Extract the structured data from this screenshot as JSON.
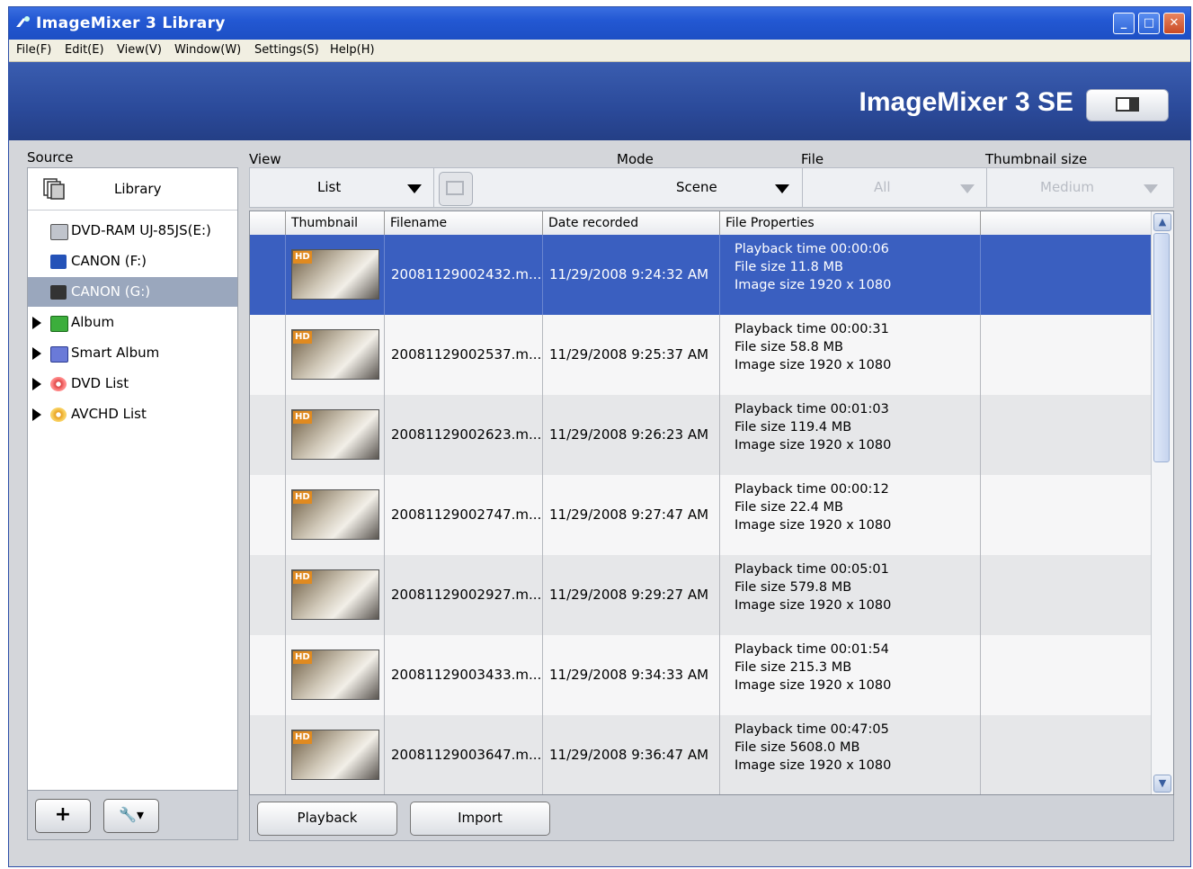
{
  "window": {
    "title": "ImageMixer 3 Library"
  },
  "menu": [
    "File(F)",
    "Edit(E)",
    "View(V)",
    "Window(W)",
    "Settings(S)",
    "Help(H)"
  ],
  "brand": {
    "logo": "ImageMixer 3 SE"
  },
  "source": {
    "label": "Source",
    "library": "Library",
    "items": [
      {
        "label": "DVD-RAM UJ-85JS(E:)",
        "icon": "dvd-drive-icon"
      },
      {
        "label": "CANON (F:)",
        "icon": "memory-card-icon"
      },
      {
        "label": "CANON (G:)",
        "icon": "camcorder-icon",
        "selected": true
      },
      {
        "label": "Album",
        "icon": "album-icon"
      },
      {
        "label": "Smart Album",
        "icon": "smart-album-icon"
      },
      {
        "label": "DVD List",
        "icon": "dvd-list-icon"
      },
      {
        "label": "AVCHD List",
        "icon": "avchd-list-icon"
      }
    ],
    "add_button": "+",
    "tools_button": "tools"
  },
  "toolbar": {
    "view_label": "View",
    "view_value": "List",
    "mode_label": "Mode",
    "mode_value": "Scene",
    "file_label": "File",
    "file_value": "All",
    "thumb_label": "Thumbnail size",
    "thumb_value": "Medium"
  },
  "table": {
    "headers": [
      "Thumbnail",
      "Filename",
      "Date recorded",
      "File Properties"
    ],
    "rows": [
      {
        "filename": "20081129002432.m...",
        "date": "11/29/2008 9:24:32 AM",
        "playback": "Playback time 00:00:06",
        "size": "File size 11.8 MB",
        "image": "Image size 1920 x 1080"
      },
      {
        "filename": "20081129002537.m...",
        "date": "11/29/2008 9:25:37 AM",
        "playback": "Playback time 00:00:31",
        "size": "File size 58.8 MB",
        "image": "Image size 1920 x 1080"
      },
      {
        "filename": "20081129002623.m...",
        "date": "11/29/2008 9:26:23 AM",
        "playback": "Playback time 00:01:03",
        "size": "File size 119.4 MB",
        "image": "Image size 1920 x 1080"
      },
      {
        "filename": "20081129002747.m...",
        "date": "11/29/2008 9:27:47 AM",
        "playback": "Playback time 00:00:12",
        "size": "File size 22.4 MB",
        "image": "Image size 1920 x 1080"
      },
      {
        "filename": "20081129002927.m...",
        "date": "11/29/2008 9:29:27 AM",
        "playback": "Playback time 00:05:01",
        "size": "File size 579.8 MB",
        "image": "Image size 1920 x 1080"
      },
      {
        "filename": "20081129003433.m...",
        "date": "11/29/2008 9:34:33 AM",
        "playback": "Playback time 00:01:54",
        "size": "File size 215.3 MB",
        "image": "Image size 1920 x 1080"
      },
      {
        "filename": "20081129003647.m...",
        "date": "11/29/2008 9:36:47 AM",
        "playback": "Playback time 00:47:05",
        "size": "File size 5608.0 MB",
        "image": "Image size 1920 x 1080"
      }
    ]
  },
  "actions": {
    "playback": "Playback",
    "import": "Import"
  },
  "colors": {
    "selection": "#3a5fc0",
    "titlebar": "#2358d3",
    "banner": "#2b4a9a"
  }
}
